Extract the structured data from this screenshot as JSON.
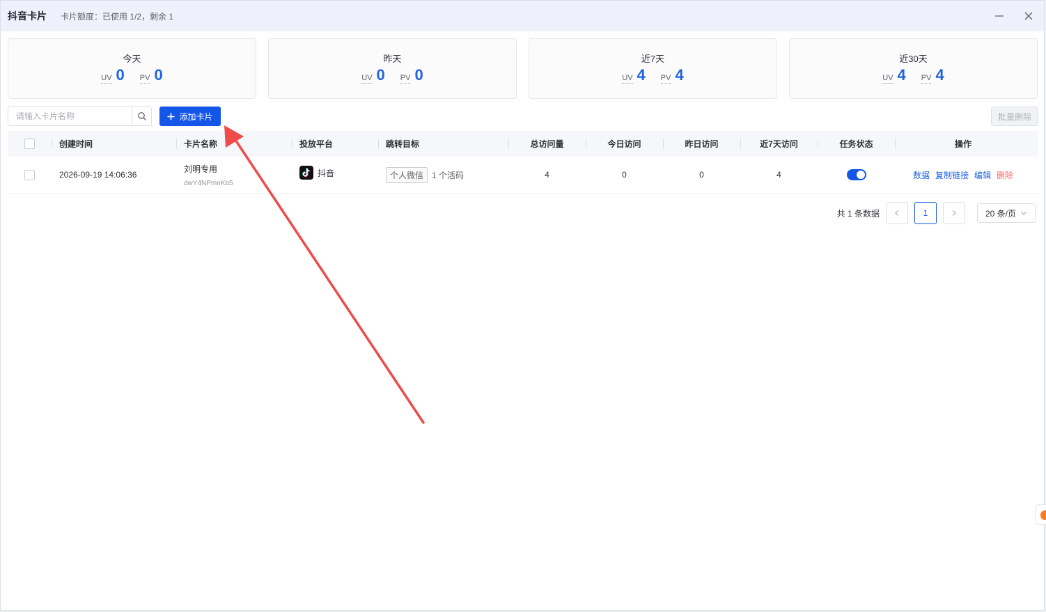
{
  "window": {
    "title": "抖音卡片",
    "quota": "卡片额度：已使用 1/2，剩余 1"
  },
  "stats": [
    {
      "title": "今天",
      "uv_label": "UV",
      "uv": "0",
      "pv_label": "PV",
      "pv": "0"
    },
    {
      "title": "昨天",
      "uv_label": "UV",
      "uv": "0",
      "pv_label": "PV",
      "pv": "0"
    },
    {
      "title": "近7天",
      "uv_label": "UV",
      "uv": "4",
      "pv_label": "PV",
      "pv": "4"
    },
    {
      "title": "近30天",
      "uv_label": "UV",
      "uv": "4",
      "pv_label": "PV",
      "pv": "4"
    }
  ],
  "toolbar": {
    "search_placeholder": "请输入卡片名称",
    "add_label": "添加卡片",
    "batch_delete_label": "批量删除"
  },
  "table": {
    "headers": {
      "time": "创建时间",
      "name": "卡片名称",
      "platform": "投放平台",
      "target": "跳转目标",
      "total": "总访问量",
      "today": "今日访问",
      "yesterday": "昨日访问",
      "week": "近7天访问",
      "status": "任务状态",
      "ops": "操作"
    },
    "rows": [
      {
        "time": "2026-09-19 14:06:36",
        "name": "刘明专用",
        "code": "dwY4NPmnKb5",
        "platform": "抖音",
        "target_tag": "个人微信",
        "target_count": "1 个活码",
        "total": "4",
        "today": "0",
        "yesterday": "0",
        "week": "4",
        "status_on": true,
        "ops": {
          "data": "数据",
          "copy": "复制链接",
          "edit": "编辑",
          "delete": "删除"
        }
      }
    ]
  },
  "pagination": {
    "total_text": "共 1 条数据",
    "current_page": "1",
    "page_size": "20 条/页"
  },
  "colors": {
    "accent": "#1456e8",
    "danger": "#f56c6c",
    "annotation_arrow": "#ef4b4b"
  }
}
